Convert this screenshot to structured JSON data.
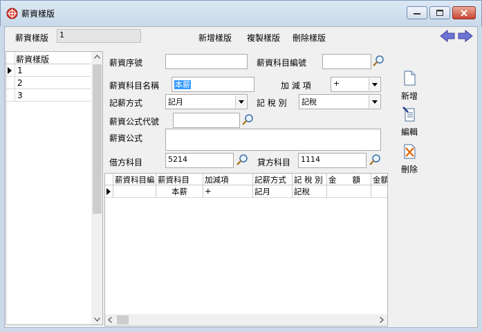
{
  "window": {
    "title": "薪資樣版"
  },
  "topbar": {
    "template_label": "薪資樣版",
    "template_value": "1",
    "menu": [
      "新增樣版",
      "複製樣版",
      "刪除樣版"
    ]
  },
  "left_grid": {
    "header": "薪資樣版",
    "rows": [
      "1",
      "2",
      "3"
    ]
  },
  "form": {
    "seq_label": "薪資序號",
    "seq_value": "",
    "item_code_label": "薪資科目編號",
    "item_code_value": "",
    "item_name_label": "薪資科目名稱",
    "item_name_value": "本薪",
    "addsub_label": "加 減 項",
    "addsub_value": "+",
    "method_label": "記薪方式",
    "method_value": "記月",
    "tax_label": "記 稅 別",
    "tax_value": "記稅",
    "formula_code_label": "薪資公式代號",
    "formula_code_value": "",
    "formula_label": "薪資公式",
    "formula_value": "",
    "debit_label": "借方科目",
    "debit_value": "5214",
    "credit_label": "貸方科目",
    "credit_value": "1114"
  },
  "bottom_grid": {
    "headers": [
      "薪資科目編",
      "薪資科目",
      "加減項",
      "記薪方式",
      "記 稅 別",
      "金　　額",
      "金額"
    ],
    "rows": [
      [
        "",
        "本薪",
        "+",
        "記月",
        "記稅",
        "",
        ""
      ]
    ]
  },
  "toolbar": {
    "add_label": "新增",
    "edit_label": "編輯",
    "delete_label": "刪除"
  }
}
